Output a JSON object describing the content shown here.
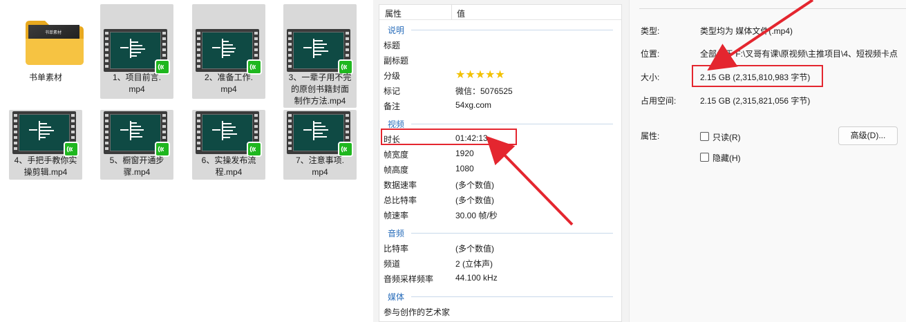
{
  "explorer": {
    "items": [
      {
        "line1": "书单素材",
        "line2": "",
        "line3": "",
        "type": "folder"
      },
      {
        "line1": "1、项目前言.",
        "line2": "mp4",
        "line3": "",
        "type": "video"
      },
      {
        "line1": "2、准备工作.",
        "line2": "mp4",
        "line3": "",
        "type": "video"
      },
      {
        "line1": "3、一辈子用不完",
        "line2": "的原创书籍封面",
        "line3": "制作方法.mp4",
        "type": "video"
      },
      {
        "line1": "4、手把手教你实",
        "line2": "操剪辑.mp4",
        "line3": "",
        "type": "video"
      },
      {
        "line1": "5、橱窗开通步",
        "line2": "骤.mp4",
        "line3": "",
        "type": "video"
      },
      {
        "line1": "6、实操发布流",
        "line2": "程.mp4",
        "line3": "",
        "type": "video"
      },
      {
        "line1": "7、注意事项.",
        "line2": "mp4",
        "line3": "",
        "type": "video"
      }
    ],
    "folder_thumb_text": "书单素材"
  },
  "details": {
    "col_property": "属性",
    "col_value": "值",
    "groups": {
      "desc": "说明",
      "video": "视频",
      "audio": "音频",
      "media": "媒体"
    },
    "rows": {
      "title": {
        "label": "标题",
        "value": ""
      },
      "subtitle": {
        "label": "副标题",
        "value": ""
      },
      "rating": {
        "label": "分级",
        "value": "★★★★★"
      },
      "tags": {
        "label": "标记",
        "value": "微信：5076525"
      },
      "comments": {
        "label": "备注",
        "value": "54xg.com"
      },
      "length": {
        "label": "时长",
        "value": "01:42:13"
      },
      "frame_width": {
        "label": "帧宽度",
        "value": "1920"
      },
      "frame_height": {
        "label": "帧高度",
        "value": "1080"
      },
      "data_rate": {
        "label": "数据速率",
        "value": "(多个数值)"
      },
      "total_bitrate": {
        "label": "总比特率",
        "value": "(多个数值)"
      },
      "frame_rate": {
        "label": "帧速率",
        "value": "30.00 帧/秒"
      },
      "bitrate": {
        "label": "比特率",
        "value": "(多个数值)"
      },
      "channels": {
        "label": "频道",
        "value": "2 (立体声)"
      },
      "sample_rate": {
        "label": "音频采样频率",
        "value": "44.100 kHz"
      },
      "artists": {
        "label": "参与创作的艺术家",
        "value": ""
      }
    }
  },
  "props": {
    "type": {
      "label": "类型:",
      "value": "类型均为 媒体文件(.mp4)"
    },
    "location": {
      "label": "位置:",
      "value": "全部位于 F:\\叉哥有课\\原视频\\主推项目\\4、短视频卡点"
    },
    "size": {
      "label": "大小:",
      "value": "2.15 GB (2,315,810,983 字节)"
    },
    "disk_size": {
      "label": "占用空间:",
      "value": "2.15 GB (2,315,821,056 字节)"
    },
    "attributes": {
      "label": "属性:"
    },
    "readonly_label": "只读(R)",
    "hidden_label": "隐藏(H)",
    "advanced_button": "高级(D)..."
  },
  "colors": {
    "annotation_red": "#e4262f",
    "badge_green": "#1fb71f",
    "group_blue": "#2a6ebb",
    "star_gold": "#f2c100"
  }
}
